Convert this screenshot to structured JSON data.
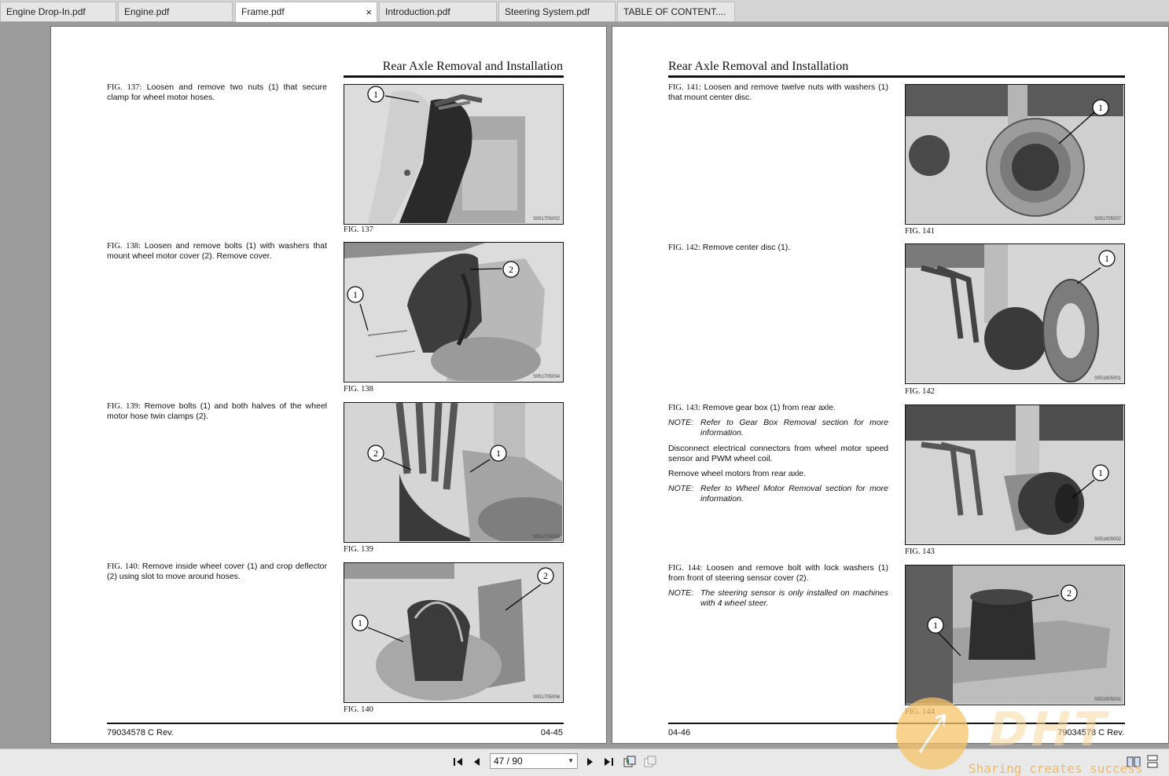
{
  "tabs": [
    {
      "label": "Engine Drop-In.pdf",
      "active": false
    },
    {
      "label": "Engine.pdf",
      "active": false
    },
    {
      "label": "Frame.pdf",
      "active": true
    },
    {
      "label": "Introduction.pdf",
      "active": false
    },
    {
      "label": "Steering System.pdf",
      "active": false
    },
    {
      "label": "TABLE OF CONTENT....",
      "active": false
    }
  ],
  "tab_close_icon": "×",
  "left_page": {
    "title": "Rear Axle Removal and Installation",
    "steps": [
      {
        "fig": "FIG. 137:",
        "text": "Loosen and remove two nuts (1) that secure clamp for wheel motor hoses."
      },
      {
        "fig": "FIG. 138:",
        "text": "Loosen and remove bolts (1) with washers that mount wheel motor cover (2). Remove cover."
      },
      {
        "fig": "FIG. 139:",
        "text": "Remove bolts (1) and both halves of the wheel motor hose twin clamps (2)."
      },
      {
        "fig": "FIG. 140:",
        "text": "Remove inside wheel cover (1) and crop deflector (2) using slot to move around hoses."
      }
    ],
    "figures": [
      {
        "caption": "FIG. 137",
        "code": "S051705002",
        "callouts": [
          "1"
        ]
      },
      {
        "caption": "FIG. 138",
        "code": "S051705004",
        "callouts": [
          "1",
          "2"
        ]
      },
      {
        "caption": "FIG. 139",
        "code": "S051705005",
        "callouts": [
          "2",
          "1"
        ]
      },
      {
        "caption": "FIG. 140",
        "code": "S051705006",
        "callouts": [
          "1",
          "2"
        ]
      }
    ],
    "footer_left": "79034578 C Rev.",
    "footer_right": "04-45"
  },
  "right_page": {
    "title": "Rear Axle Removal and Installation",
    "steps": [
      {
        "fig": "FIG. 141:",
        "text": "Loosen and remove twelve nuts with washers (1) that mount center disc."
      },
      {
        "fig": "FIG. 142:",
        "text": "Remove center disc (1)."
      },
      {
        "fig": "FIG. 143:",
        "text": "Remove gear box (1) from rear axle."
      },
      {
        "fig": "FIG. 144:",
        "text": "Loosen and remove bolt with lock washers (1) from front of steering sensor cover (2)."
      }
    ],
    "notes": {
      "label": "NOTE:",
      "gearbox": "Refer to Gear Box Removal section for more information.",
      "wheelmotor": "Refer to Wheel Motor Removal section for more information.",
      "sensor": "The steering sensor is only installed on machines with 4 wheel steer."
    },
    "paragraphs": {
      "disconnect": "Disconnect electrical connectors from wheel motor speed sensor and PWM wheel coil.",
      "remove_motors": "Remove wheel motors from rear axle."
    },
    "figures": [
      {
        "caption": "FIG. 141",
        "code": "S051705007",
        "callouts": [
          "1"
        ]
      },
      {
        "caption": "FIG. 142",
        "code": "S051805001",
        "callouts": [
          "1"
        ]
      },
      {
        "caption": "FIG. 143",
        "code": "S051805002",
        "callouts": [
          "1"
        ]
      },
      {
        "caption": "FIG. 144",
        "code": "S051905001",
        "callouts": [
          "2",
          "1"
        ]
      }
    ],
    "footer_left": "04-46",
    "footer_right": "79034578 C Rev."
  },
  "toolbar": {
    "first_icon": "first-page-icon",
    "prev_icon": "prev-page-icon",
    "page_value": "47 / 90",
    "next_icon": "next-page-icon",
    "last_icon": "last-page-icon"
  },
  "watermark": {
    "logo_text": "DHT",
    "tagline": "Sharing creates success"
  }
}
